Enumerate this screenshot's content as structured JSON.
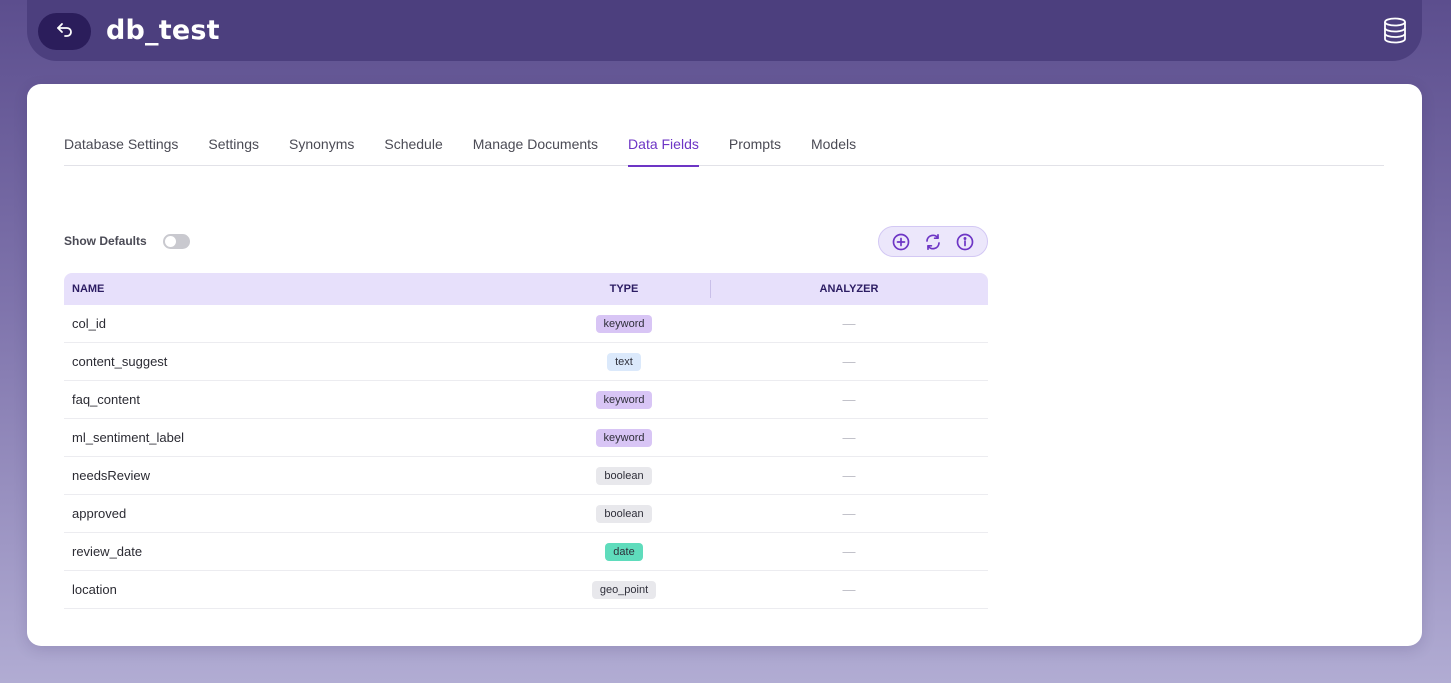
{
  "header": {
    "title": "db_test",
    "back_icon": "undo-arrow-icon",
    "db_icon": "database-icon"
  },
  "tabs": [
    {
      "label": "Database Settings",
      "active": false
    },
    {
      "label": "Settings",
      "active": false
    },
    {
      "label": "Synonyms",
      "active": false
    },
    {
      "label": "Schedule",
      "active": false
    },
    {
      "label": "Manage Documents",
      "active": false
    },
    {
      "label": "Data Fields",
      "active": true
    },
    {
      "label": "Prompts",
      "active": false
    },
    {
      "label": "Models",
      "active": false
    }
  ],
  "controls": {
    "show_defaults_label": "Show Defaults",
    "show_defaults_on": false,
    "actions": [
      "add-circle-icon",
      "refresh-icon",
      "info-icon"
    ]
  },
  "table": {
    "columns": [
      "NAME",
      "TYPE",
      "ANALYZER"
    ],
    "rows": [
      {
        "name": "col_id",
        "type": "keyword",
        "analyzer": "—"
      },
      {
        "name": "content_suggest",
        "type": "text",
        "analyzer": "—"
      },
      {
        "name": "faq_content",
        "type": "keyword",
        "analyzer": "—"
      },
      {
        "name": "ml_sentiment_label",
        "type": "keyword",
        "analyzer": "—"
      },
      {
        "name": "needsReview",
        "type": "boolean",
        "analyzer": "—"
      },
      {
        "name": "approved",
        "type": "boolean",
        "analyzer": "—"
      },
      {
        "name": "review_date",
        "type": "date",
        "analyzer": "—"
      },
      {
        "name": "location",
        "type": "geo_point",
        "analyzer": "—"
      }
    ]
  },
  "colors": {
    "accent": "#6d35c5",
    "header_bg": "#4c3f7e",
    "back_button_bg": "#2b1d5b",
    "keyword_badge": "#d8c5f5",
    "text_badge": "#dbe9fb",
    "boolean_badge": "#e8e8ec",
    "date_badge": "#5fdcbc"
  }
}
